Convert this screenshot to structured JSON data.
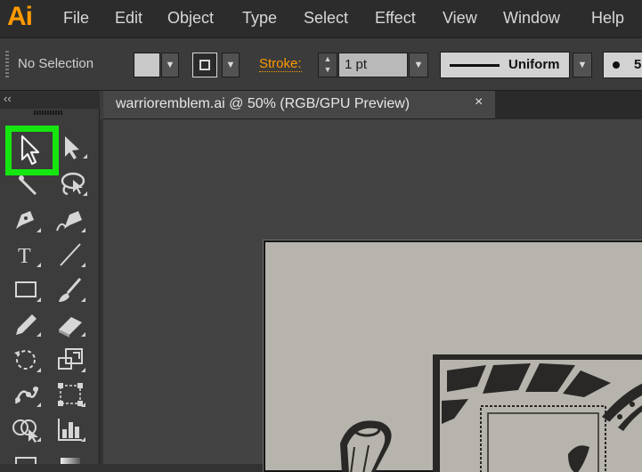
{
  "app": {
    "logo": "Ai"
  },
  "menu": [
    "File",
    "Edit",
    "Object",
    "Type",
    "Select",
    "Effect",
    "View",
    "Window",
    "Help"
  ],
  "control": {
    "selection_status": "No Selection",
    "stroke_label": "Stroke:",
    "stroke_weight": "1 pt",
    "profile_label": "Uniform",
    "brush_size": "5"
  },
  "panel": {
    "collapse_glyph": "‹‹"
  },
  "document": {
    "tab_title": "warrioremblem.ai @ 50% (RGB/GPU Preview)",
    "close_glyph": "×"
  },
  "tools": [
    {
      "name": "selection-tool",
      "selected": true
    },
    {
      "name": "direct-selection-tool"
    },
    {
      "name": "magic-wand-tool"
    },
    {
      "name": "lasso-tool"
    },
    {
      "name": "pen-tool"
    },
    {
      "name": "curvature-tool"
    },
    {
      "name": "type-tool",
      "glyph": "T"
    },
    {
      "name": "line-segment-tool"
    },
    {
      "name": "rectangle-tool"
    },
    {
      "name": "paintbrush-tool"
    },
    {
      "name": "pencil-tool"
    },
    {
      "name": "eraser-tool"
    },
    {
      "name": "rotate-tool"
    },
    {
      "name": "scale-tool"
    },
    {
      "name": "puppet-warp-tool"
    },
    {
      "name": "free-transform-tool"
    },
    {
      "name": "shape-builder-tool"
    },
    {
      "name": "chart-tool"
    },
    {
      "name": "artboard-tool"
    },
    {
      "name": "gradient-tool"
    }
  ],
  "colors": {
    "accent_orange": "#ff9a00",
    "selection_highlight": "#15e610",
    "menubar_bg": "#2c2c2c",
    "panel_bg": "#3c3c3c",
    "artboard_bg": "#b7b4ad",
    "artwork_ink": "#2a2826"
  }
}
